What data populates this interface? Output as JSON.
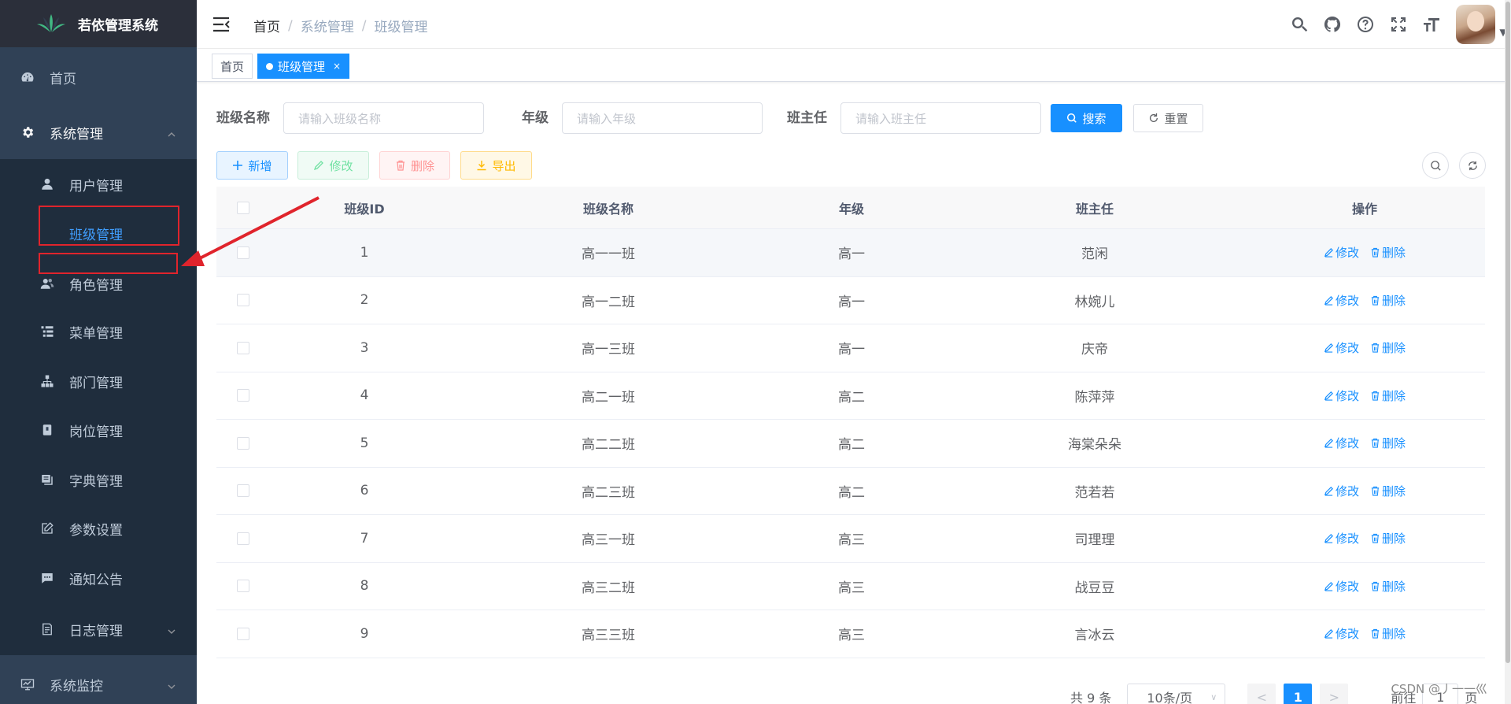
{
  "app": {
    "title": "若依管理系统"
  },
  "sidebar": {
    "home": "首页",
    "system": "系统管理",
    "items": [
      {
        "label": "用户管理"
      },
      {
        "label": "班级管理"
      },
      {
        "label": "角色管理"
      },
      {
        "label": "菜单管理"
      },
      {
        "label": "部门管理"
      },
      {
        "label": "岗位管理"
      },
      {
        "label": "字典管理"
      },
      {
        "label": "参数设置"
      },
      {
        "label": "通知公告"
      },
      {
        "label": "日志管理"
      }
    ],
    "monitor": "系统监控"
  },
  "breadcrumb": [
    "首页",
    "系统管理",
    "班级管理"
  ],
  "tags": {
    "home": "首页",
    "active": "班级管理",
    "close": "×"
  },
  "search": {
    "class_name_label": "班级名称",
    "class_name_placeholder": "请输入班级名称",
    "grade_label": "年级",
    "grade_placeholder": "请输入年级",
    "teacher_label": "班主任",
    "teacher_placeholder": "请输入班主任",
    "search_btn": "搜索",
    "reset_btn": "重置"
  },
  "toolbar": {
    "add": "新增",
    "edit": "修改",
    "delete": "删除",
    "export": "导出"
  },
  "table": {
    "headers": {
      "id": "班级ID",
      "name": "班级名称",
      "grade": "年级",
      "teacher": "班主任",
      "op": "操作"
    },
    "op_edit": "修改",
    "op_delete": "删除",
    "rows": [
      {
        "id": "1",
        "name": "高一一班",
        "grade": "高一",
        "teacher": "范闲"
      },
      {
        "id": "2",
        "name": "高一二班",
        "grade": "高一",
        "teacher": "林婉儿"
      },
      {
        "id": "3",
        "name": "高一三班",
        "grade": "高一",
        "teacher": "庆帝"
      },
      {
        "id": "4",
        "name": "高二一班",
        "grade": "高二",
        "teacher": "陈萍萍"
      },
      {
        "id": "5",
        "name": "高二二班",
        "grade": "高二",
        "teacher": "海棠朵朵"
      },
      {
        "id": "6",
        "name": "高二三班",
        "grade": "高二",
        "teacher": "范若若"
      },
      {
        "id": "7",
        "name": "高三一班",
        "grade": "高三",
        "teacher": "司理理"
      },
      {
        "id": "8",
        "name": "高三二班",
        "grade": "高三",
        "teacher": "战豆豆"
      },
      {
        "id": "9",
        "name": "高三三班",
        "grade": "高三",
        "teacher": "言冰云"
      }
    ]
  },
  "pagination": {
    "total": "共 9 条",
    "page_size": "10条/页",
    "prev": "<",
    "current": "1",
    "next": ">",
    "goto_prefix": "前往",
    "goto_value": "1",
    "goto_suffix": "页"
  },
  "watermark": "CSDN @丿一一巛",
  "colors": {
    "sidebar_bg": "#304156",
    "primary": "#1890ff",
    "annotation": "#e0242c"
  }
}
